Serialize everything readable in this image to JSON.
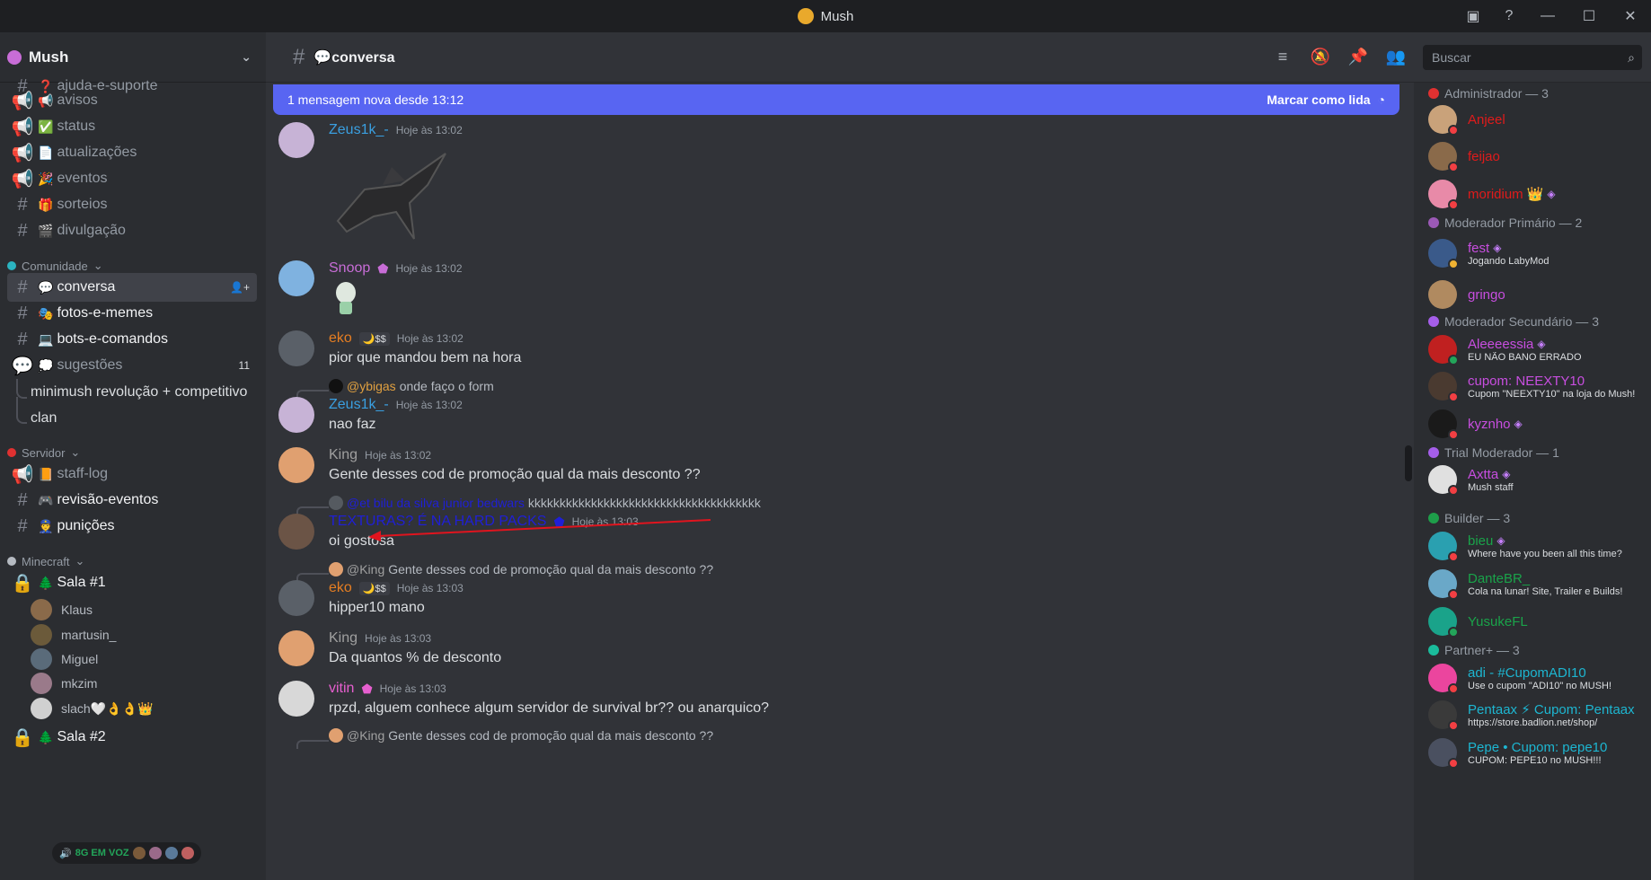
{
  "window": {
    "title": "Mush"
  },
  "server": {
    "name": "Mush"
  },
  "channels_top": [
    {
      "type": "text",
      "emoji": "❓",
      "name": "ajuda-e-suporte"
    },
    {
      "type": "announce",
      "emoji": "📢",
      "name": "avisos"
    },
    {
      "type": "announce",
      "emoji": "✅",
      "name": "status"
    },
    {
      "type": "announce",
      "emoji": "📄",
      "name": "atualizações"
    },
    {
      "type": "announce",
      "emoji": "🎉",
      "name": "eventos"
    },
    {
      "type": "text",
      "emoji": "🎁",
      "name": "sorteios"
    },
    {
      "type": "text",
      "emoji": "🎬",
      "name": "divulgação"
    }
  ],
  "categories": {
    "comunidade": "Comunidade",
    "servidor": "Servidor",
    "minecraft": "Minecraft"
  },
  "channels_comunidade": [
    {
      "emoji": "💬",
      "name": "conversa"
    },
    {
      "emoji": "🎭",
      "name": "fotos-e-memes"
    },
    {
      "emoji": "💻",
      "name": "bots-e-comandos"
    },
    {
      "emoji": "💭",
      "name": "sugestões",
      "count": "11"
    }
  ],
  "threads": [
    "minimush revolução + competitivo",
    "clan"
  ],
  "channels_servidor": [
    {
      "emoji": "📙",
      "name": "staff-log"
    },
    {
      "emoji": "🎮",
      "name": "revisão-eventos"
    },
    {
      "emoji": "👮",
      "name": "punições"
    }
  ],
  "voice": {
    "room1": "Sala #1",
    "room2": "Sala #2",
    "users": [
      "Klaus",
      "martusin_",
      "Miguel",
      "mkzim",
      "slach🤍👌👌👑"
    ],
    "pill": "8G EM VOZ"
  },
  "header": {
    "channel": "💬conversa",
    "search_placeholder": "Buscar"
  },
  "new_messages": {
    "text": "1 mensagem nova desde 13:12",
    "mark": "Marcar como lida"
  },
  "messages": [
    {
      "name": "Zeus1k_-",
      "color": "#3a9fe0",
      "time": "Hoje às 13:02"
    },
    {
      "name": "Snoop",
      "color": "#c86dd7",
      "time": "Hoje às 13:02"
    },
    {
      "name": "eko",
      "color": "#e67e22",
      "tag": "🌙$$",
      "time": "Hoje às 13:02",
      "text": "pior que mandou bem na hora"
    },
    {
      "reply_name": "@ybigas",
      "reply_text": "onde faço o form",
      "name": "Zeus1k_-",
      "color": "#3a9fe0",
      "time": "Hoje às 13:02",
      "text": "nao faz"
    },
    {
      "name": "King",
      "color": "#a0a0a0",
      "time": "Hoje às 13:02",
      "text": "Gente desses cod de promoção qual da mais desconto ??"
    },
    {
      "reply_name": "@et bilu da silva junior bedwars",
      "reply_text": "kkkkkkkkkkkkkkkkkkkkkkkkkkkkkkkkkkkkk",
      "name": "TEXTURAS? É NA HARD PACKS",
      "color": "#1f1fd6",
      "time": "Hoje às 13:03",
      "text": "oi gostosa"
    },
    {
      "reply_name": "@King",
      "reply_text": "Gente desses cod de promoção qual da mais desconto ??",
      "name": "eko",
      "color": "#e67e22",
      "tag": "🌙$$",
      "time": "Hoje às 13:03",
      "text": "hipper10 mano"
    },
    {
      "name": "King",
      "color": "#a0a0a0",
      "time": "Hoje às 13:03",
      "text": "Da quantos % de desconto"
    },
    {
      "name": "vitin",
      "color": "#e65fcf",
      "time": "Hoje às 13:03",
      "text": "rpzd, alguem conhece algum servidor de survival br?? ou anarquico?"
    },
    {
      "reply_name": "@King",
      "reply_text": "Gente desses cod de promoção qual da mais desconto ??"
    }
  ],
  "roles": [
    {
      "title": "Administrador — 3",
      "color": "#e03131",
      "members": [
        {
          "name": "Anjeel",
          "color": "#e01b1b"
        },
        {
          "name": "feijao",
          "color": "#e01b1b"
        },
        {
          "name": "moridium",
          "color": "#e01b1b",
          "badge": "👑"
        }
      ]
    },
    {
      "title": "Moderador Primário — 2",
      "color": "#9b59b6",
      "members": [
        {
          "name": "fest",
          "color": "#c84ee0",
          "status": "Jogando LabyMod"
        },
        {
          "name": "gringo",
          "color": "#c84ee0"
        }
      ]
    },
    {
      "title": "Moderador Secundário — 3",
      "color": "#a55eea",
      "members": [
        {
          "name": "Aleeeessia",
          "color": "#c84ee0",
          "status": "EU NÃO BANO ERRADO"
        },
        {
          "name": "cupom: NEEXTY10",
          "color": "#c84ee0",
          "status": "Cupom \"NEEXTY10\" na loja do Mush!"
        },
        {
          "name": "kyznho",
          "color": "#c84ee0"
        }
      ]
    },
    {
      "title": "Trial Moderador — 1",
      "color": "#a55eea",
      "members": [
        {
          "name": "Axtta",
          "color": "#c84ee0",
          "status": "Mush staff"
        }
      ]
    },
    {
      "title": "Builder — 3",
      "color": "#1e9e4a",
      "members": [
        {
          "name": "bieu",
          "color": "#1aa34a",
          "status": "Where have you been all this time?"
        },
        {
          "name": "DanteBR_",
          "color": "#1aa34a",
          "status": "Cola na lunar! Site, Trailer e Builds!"
        },
        {
          "name": "YusukeFL",
          "color": "#1aa34a"
        }
      ]
    },
    {
      "title": "Partner+ — 3",
      "color": "#1abc9c",
      "members": [
        {
          "name": "adi - #CupomADI10",
          "color": "#1db6d1",
          "status": "Use o cupom \"ADI10\" no MUSH!"
        },
        {
          "name": "Pentaax ⚡ Cupom: Pentaax",
          "color": "#1db6d1",
          "status": "https://store.badlion.net/shop/"
        },
        {
          "name": "Pepe • Cupom: pepe10",
          "color": "#1db6d1",
          "status": "CUPOM: PEPE10 no MUSH!!!"
        }
      ]
    }
  ]
}
